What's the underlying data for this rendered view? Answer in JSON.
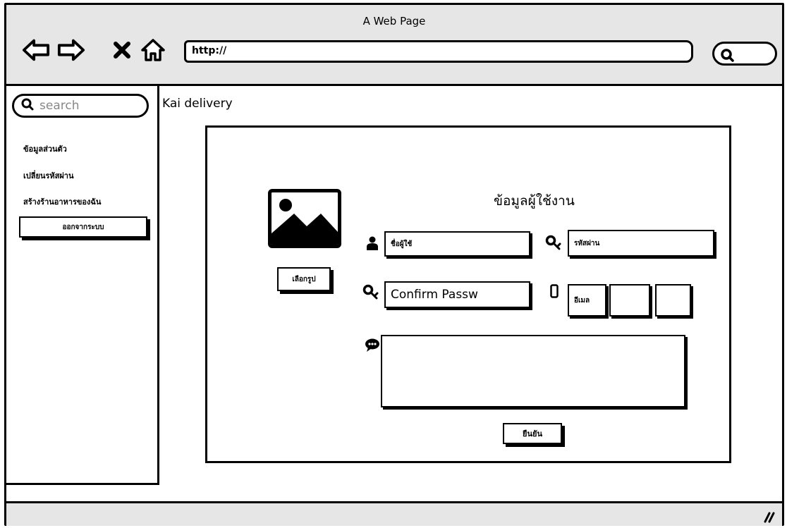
{
  "window": {
    "title": "A Web Page"
  },
  "browser": {
    "url": "http://",
    "nav_icons": [
      "back-arrow-icon",
      "forward-arrow-icon",
      "close-x-icon",
      "home-icon"
    ],
    "search_icon": "search-icon"
  },
  "sidebar": {
    "search_placeholder": "search",
    "links": [
      "ข้อมูลส่วนตัว",
      "เปลี่ยนรหัสผ่าน",
      "สร้างร้านอาหารของฉัน"
    ],
    "logout_label": "ออกจากระบบ"
  },
  "brand": "Kai delivery",
  "form": {
    "title": "ข้อมูลผู้ใช้งาน",
    "choose_image_label": "เลือกรูป",
    "username": "ชื่อผู้ใช้",
    "password": "รหัสผ่าน",
    "confirm_password": "Confirm Passw",
    "email": "อีเมล",
    "phone_box_1": "",
    "phone_box_2": "",
    "comment": "",
    "submit_label": "ยืนยัน"
  },
  "icons": {
    "user": "user-icon",
    "key": "key-icon",
    "phone": "mobile-phone-icon",
    "comment": "speech-bubble-icon",
    "image": "image-placeholder-icon"
  }
}
